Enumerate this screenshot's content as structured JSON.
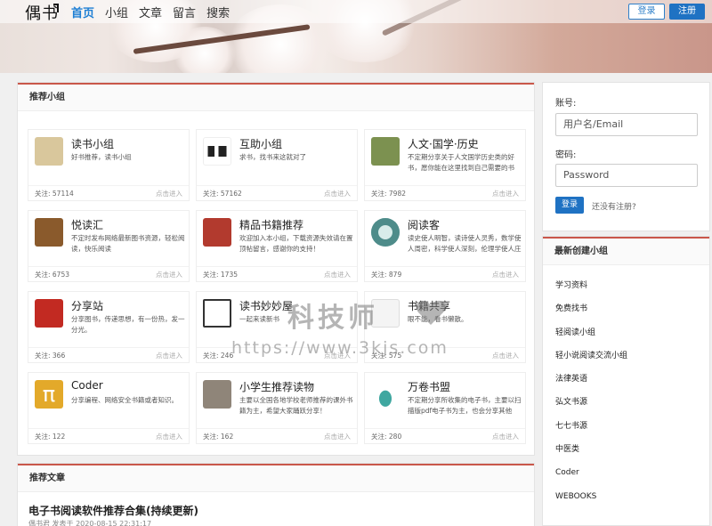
{
  "header": {
    "logo": "偶书",
    "nav": [
      "首页",
      "小组",
      "文章",
      "留言",
      "搜索"
    ],
    "login_button": "登录",
    "register_button": "注册"
  },
  "groups_panel": {
    "title": "推荐小组",
    "count_prefix": "关注: ",
    "enter_label": "点击进入",
    "items": [
      {
        "name": "读书小组",
        "desc": "好书推荐，读书小组",
        "count": "57114",
        "icon": "book-open-icon",
        "color": "#d9c79c"
      },
      {
        "name": "互助小组",
        "desc": "求书，找书来这就对了",
        "count": "57162",
        "icon": "huzhu-logo-icon",
        "color": "#ffffff"
      },
      {
        "name": "人文·国学·历史",
        "desc": "不定期分享关于人文国学历史类的好书，愿你能在这里找到自己需要的书",
        "count": "7982",
        "icon": "bronze-ding-icon",
        "color": "#7c9150"
      },
      {
        "name": "悦读汇",
        "desc": "不定时发布网络最新图书资源，轻松阅读，快乐阅读",
        "count": "6753",
        "icon": "open-book-icon",
        "color": "#8a5a2c"
      },
      {
        "name": "精品书籍推荐",
        "desc": "欢迎加入本小组，下载资源失效请在置顶帖留言，感谢你的支持！",
        "count": "1735",
        "icon": "seal-icon",
        "color": "#b23a2e"
      },
      {
        "name": "阅读客",
        "desc": "读史使人明智，读诗使人灵秀，数学使人周密，科学使人深刻，伦理学使人庄重",
        "count": "879",
        "icon": "reader-circle-icon",
        "color": "#4e8c8a"
      },
      {
        "name": "分享站",
        "desc": "分享图书，传递思想，有一份热，发一分光。",
        "count": "366",
        "icon": "calligraphy-icon",
        "color": "#c22a22"
      },
      {
        "name": "读书妙妙屋",
        "desc": "一起来读新书",
        "count": "246",
        "icon": "house-icon",
        "color": "#ffffff"
      },
      {
        "name": "书籍共享",
        "desc": "眼不能，看书懒散。",
        "count": "575",
        "icon": "share-icon",
        "color": "#f4f4f4"
      },
      {
        "name": "Coder",
        "desc": "分享编程、网络安全书籍或者知识。",
        "count": "122",
        "icon": "pi-icon",
        "color": "#e3a92a"
      },
      {
        "name": "小学生推荐读物",
        "desc": "主要以全国各地学校老师推荐的课外书籍为主，希望大家踊跃分享！",
        "count": "162",
        "icon": "calligraphy-scroll-icon",
        "color": "#8f8579"
      },
      {
        "name": "万卷书盟",
        "desc": "不定期分享所收集的电子书，主要以扫描版pdf电子书为主，也会分享其他",
        "count": "280",
        "icon": "jade-boat-icon",
        "color": "#ffffff"
      }
    ]
  },
  "login_panel": {
    "account_label": "账号:",
    "account_placeholder": "用户名/Email",
    "password_label": "密码:",
    "password_placeholder": "Password",
    "submit_label": "登录",
    "no_account": "还没有注册?"
  },
  "new_groups_panel": {
    "title": "最新创建小组",
    "items": [
      "学习资料",
      "免费找书",
      "轻阅读小组",
      "轻小说阅读交流小组",
      "法律英语",
      "弘文书源",
      "七七书源",
      "中医类",
      "Coder",
      "WEBOOKS"
    ]
  },
  "articles_panel": {
    "title": "推荐文章",
    "first_article_title": "电子书阅读软件推荐合集(持续更新)",
    "first_article_meta": "偶书君 发表于 2020-08-15 22:31:17"
  },
  "watermark": {
    "title": "科技师",
    "url": "https://www.3kjs.com"
  }
}
